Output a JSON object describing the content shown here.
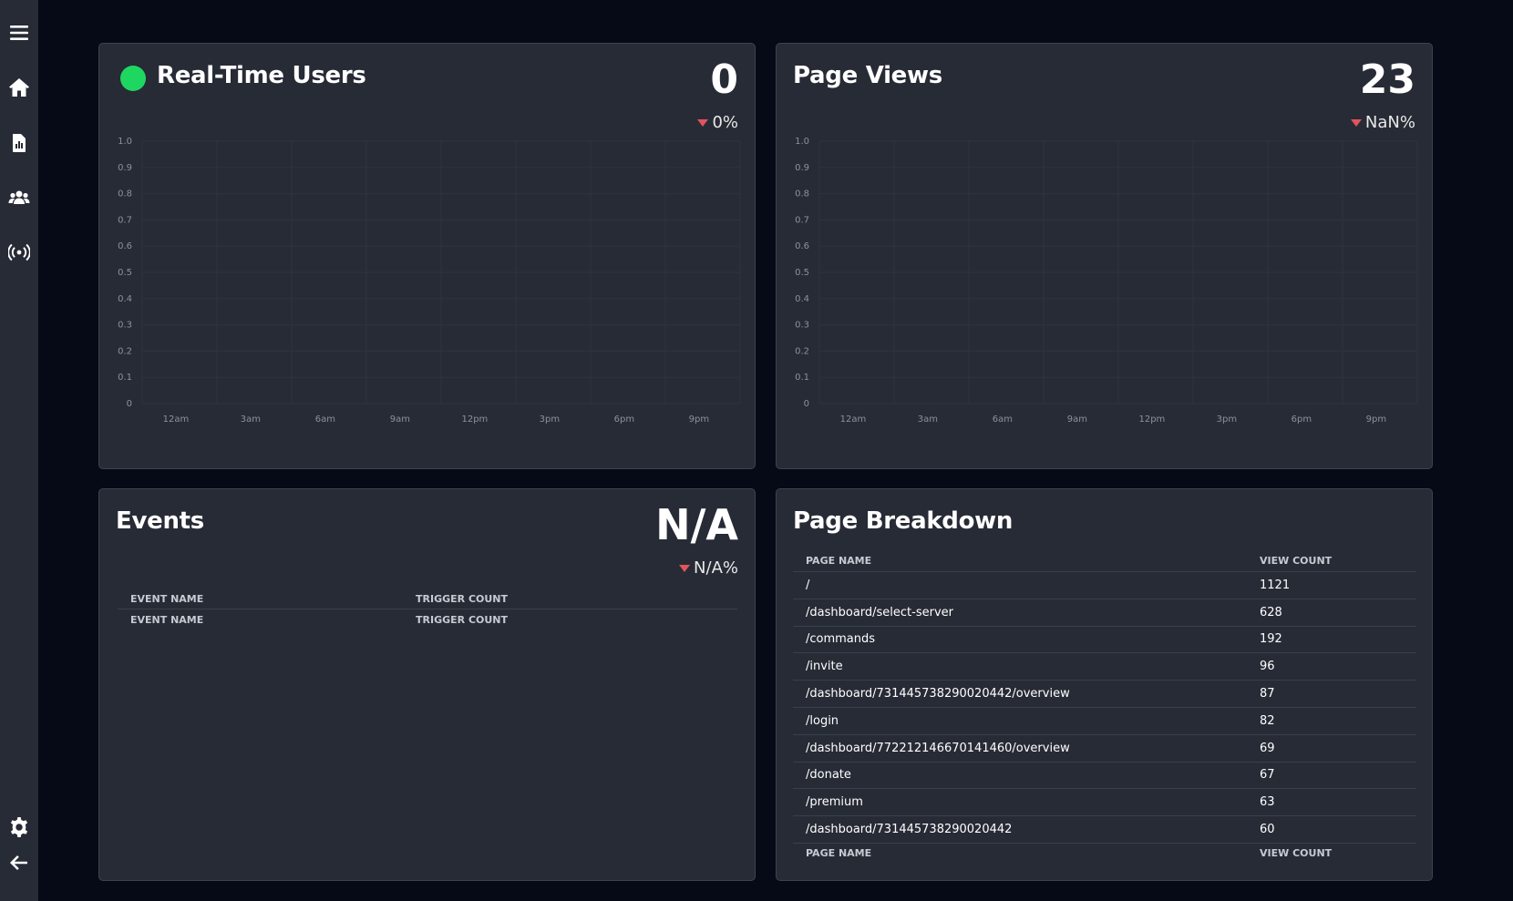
{
  "sidebar": {
    "icons": [
      "menu-icon",
      "home-icon",
      "report-icon",
      "users-icon",
      "broadcast-icon",
      "gear-icon",
      "back-arrow-icon"
    ]
  },
  "realtime": {
    "title": "Real-Time Users",
    "value": "0",
    "change": "0%",
    "status_color": "#1ed760",
    "trend_color": "#e0545c"
  },
  "pageviews": {
    "title": "Page Views",
    "value": "23",
    "change": "NaN%"
  },
  "events": {
    "title": "Events",
    "value": "N/A",
    "change": "N/A%",
    "columns": [
      "EVENT NAME",
      "TRIGGER COUNT"
    ],
    "footer": [
      "EVENT NAME",
      "TRIGGER COUNT"
    ]
  },
  "breakdown": {
    "title": "Page Breakdown",
    "columns": [
      "PAGE NAME",
      "VIEW COUNT"
    ],
    "rows": [
      [
        "/",
        "1121"
      ],
      [
        "/dashboard/select-server",
        "628"
      ],
      [
        "/commands",
        "192"
      ],
      [
        "/invite",
        "96"
      ],
      [
        "/dashboard/731445738290020442/overview",
        "87"
      ],
      [
        "/login",
        "82"
      ],
      [
        "/dashboard/772212146670141460/overview",
        "69"
      ],
      [
        "/donate",
        "67"
      ],
      [
        "/premium",
        "63"
      ],
      [
        "/dashboard/731445738290020442",
        "60"
      ]
    ],
    "footer": [
      "PAGE NAME",
      "VIEW COUNT"
    ]
  },
  "chart_data": [
    {
      "type": "line",
      "x": [
        "12am",
        "3am",
        "6am",
        "9am",
        "12pm",
        "3pm",
        "6pm",
        "9pm"
      ],
      "y_ticks": [
        "1.0",
        "0.9",
        "0.8",
        "0.7",
        "0.6",
        "0.5",
        "0.4",
        "0.3",
        "0.2",
        "0.1",
        "0"
      ],
      "ylim": [
        0,
        1
      ],
      "series": [],
      "grid": true
    },
    {
      "type": "line",
      "x": [
        "12am",
        "3am",
        "6am",
        "9am",
        "12pm",
        "3pm",
        "6pm",
        "9pm"
      ],
      "y_ticks": [
        "1.0",
        "0.9",
        "0.8",
        "0.7",
        "0.6",
        "0.5",
        "0.4",
        "0.3",
        "0.2",
        "0.1",
        "0"
      ],
      "ylim": [
        0,
        1
      ],
      "series": [],
      "grid": true
    }
  ]
}
